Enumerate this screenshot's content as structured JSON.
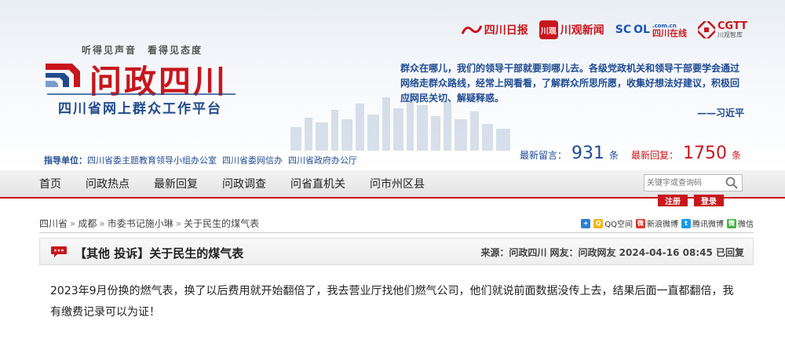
{
  "partners": [
    {
      "name": "四川日报"
    },
    {
      "badge": "川观",
      "name": "川观新闻"
    },
    {
      "name": "SC",
      "highlight": "OL",
      "red_text": "四川在线",
      "domain": ".com.cn"
    },
    {
      "name": "CGTT",
      "sub": "川观智库"
    }
  ],
  "brand": {
    "slogan": "听得见声音　看得见态度",
    "title": "问政四川",
    "subtitle": "四川省网上群众工作平台"
  },
  "quote": {
    "text": "群众在哪儿，我们的领导干部就要到哪儿去。各级党政机关和领导干部要学会通过网络走群众路线，经常上网看看，了解群众所思所愿，收集好想法好建议，积极回应网民关切、解疑释惑。",
    "author": "——习近平"
  },
  "guidance": {
    "label": "指导单位：",
    "units": [
      "四川省委主题教育领导小组办公室",
      "四川省委网信办",
      "四川省政府办公厅"
    ]
  },
  "stats": {
    "latest_messages_label": "最新留言：",
    "latest_messages": "931",
    "latest_messages_unit": "条",
    "latest_replies_label": "最新回复：",
    "latest_replies": "1750",
    "latest_replies_unit": "条"
  },
  "nav": {
    "items": [
      "首页",
      "问政热点",
      "最新回复",
      "问政调查",
      "问省直机关",
      "问市州区县"
    ],
    "search_placeholder": "关键字或查询码",
    "register": "注册",
    "login": "登录"
  },
  "breadcrumb": [
    "四川省",
    "成都",
    "市委书记施小琳",
    "关于民生的煤气表"
  ],
  "breadcrumb_sep": "»",
  "share": [
    {
      "label": "",
      "color": "#2d7fd1",
      "glyph": "+"
    },
    {
      "label": "QQ空间",
      "color": "#f2b618",
      "glyph": "Q"
    },
    {
      "label": "新浪微博",
      "color": "#e2332d",
      "glyph": "微"
    },
    {
      "label": "腾讯微博",
      "color": "#1a9be8",
      "glyph": "t"
    },
    {
      "label": "微信",
      "color": "#3fb63f",
      "glyph": "微"
    }
  ],
  "post": {
    "title": "【其他 投诉】关于民生的煤气表",
    "meta": "来源：问政四川 网友：问政网友 2024-04-16 08:45 已回复",
    "body": "2023年9月份换的燃气表，换了以后费用就开始翻倍了，我去营业厅找他们燃气公司，他们就说前面数据没传上去，结果后面一直都翻倍，我有缴费记录可以为证！"
  },
  "colors": {
    "brand_red": "#c8161d",
    "brand_blue": "#1f4b92"
  }
}
